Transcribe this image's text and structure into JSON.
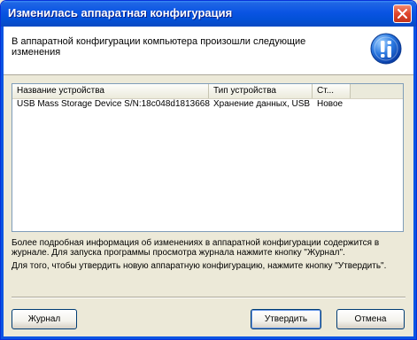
{
  "window": {
    "title": "Изменилась аппаратная конфигурация"
  },
  "header": {
    "message": "В аппаратной конфигурации компьютера произошли следующие изменения"
  },
  "table": {
    "columns": [
      "Название устройства",
      "Тип устройства",
      "Ст..."
    ],
    "rows": [
      {
        "name": "USB Mass Storage Device S/N:18c048d1813668",
        "type": "Хранение данных, USB",
        "status": "Новое"
      }
    ]
  },
  "description": {
    "line1": "Более подробная информация об изменениях в аппаратной конфигурации содержится в журнале. Для запуска программы просмотра журнала нажмите кнопку \"Журнал\".",
    "line2": "Для того, чтобы утвердить новую аппаратную конфигурацию, нажмите кнопку \"Утвердить\"."
  },
  "buttons": {
    "journal": "Журнал",
    "approve": "Утвердить",
    "cancel": "Отмена"
  },
  "colors": {
    "titlebar": "#0a54e3",
    "close": "#e0462b",
    "face": "#ece9d8"
  }
}
